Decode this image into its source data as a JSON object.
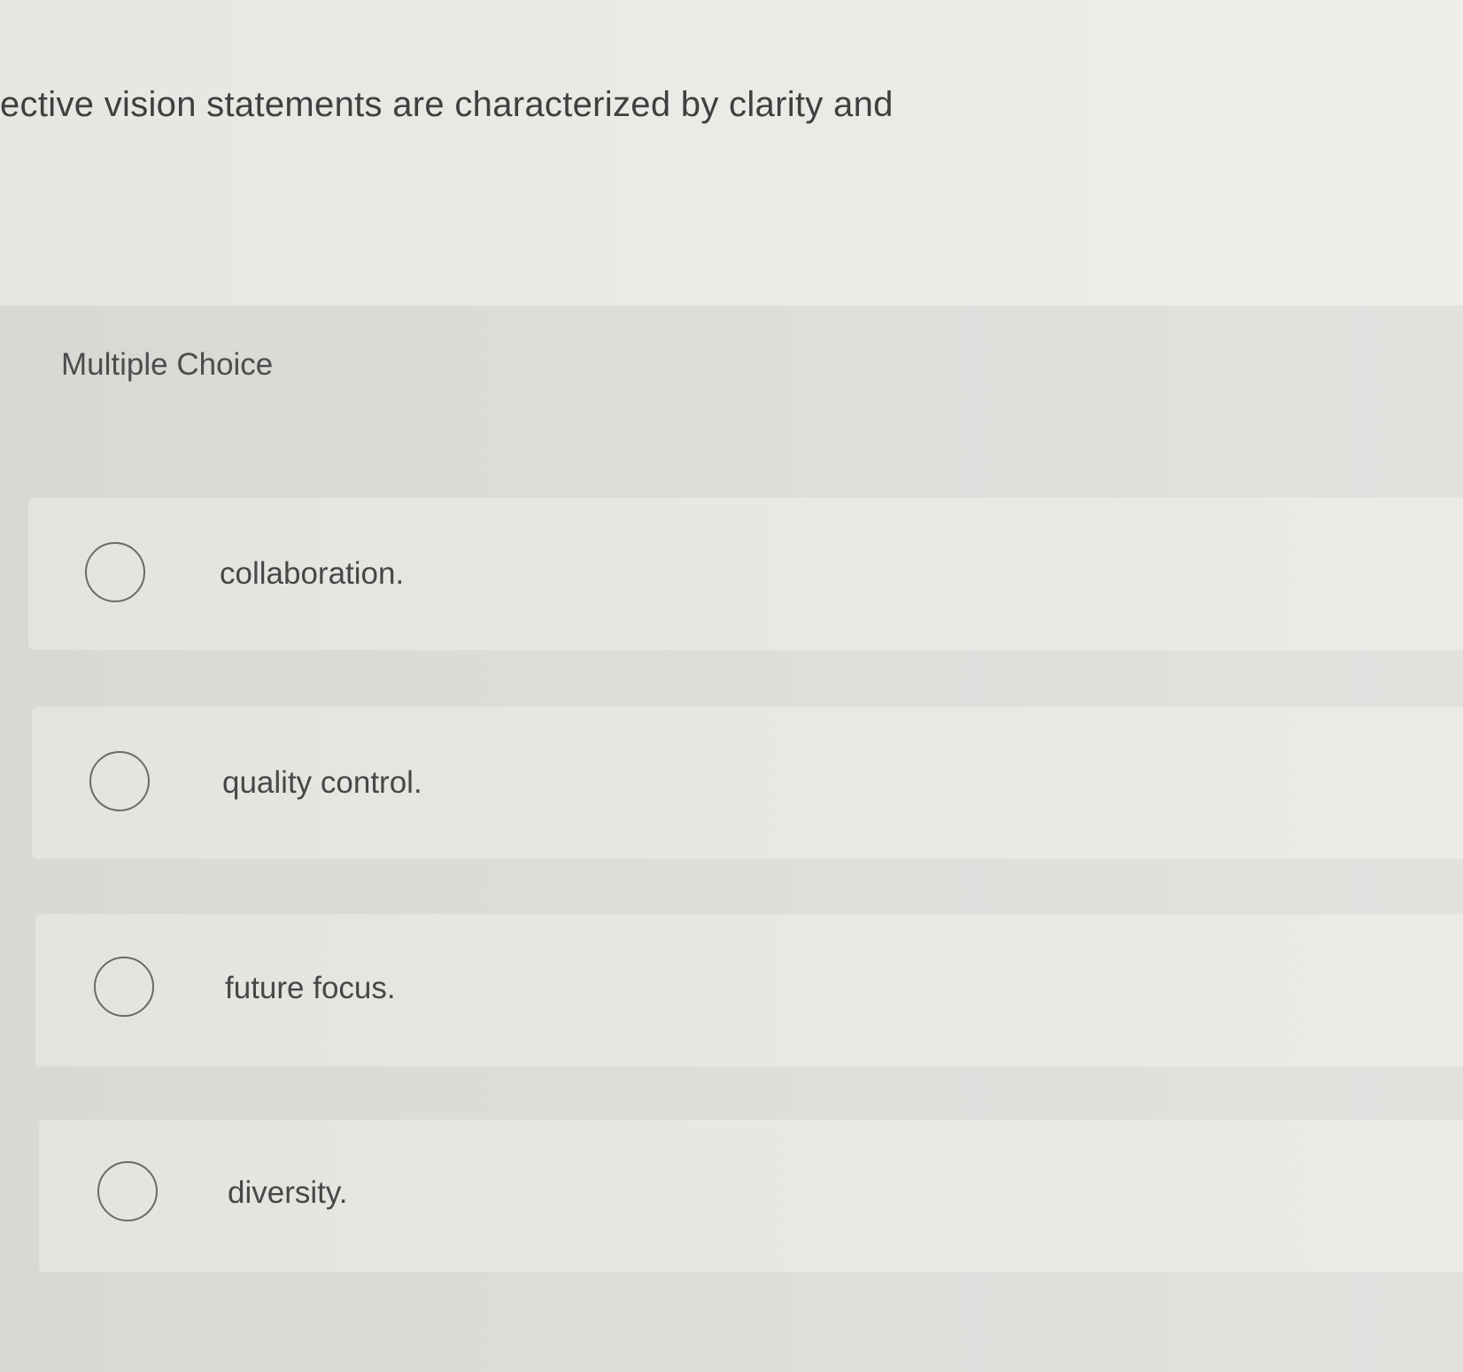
{
  "question": {
    "text": "ective vision statements are characterized by clarity and"
  },
  "question_type_label": "Multiple Choice",
  "options": [
    {
      "label": "collaboration.",
      "selected": false
    },
    {
      "label": "quality control.",
      "selected": false
    },
    {
      "label": "future focus.",
      "selected": false
    },
    {
      "label": "diversity.",
      "selected": false
    }
  ]
}
